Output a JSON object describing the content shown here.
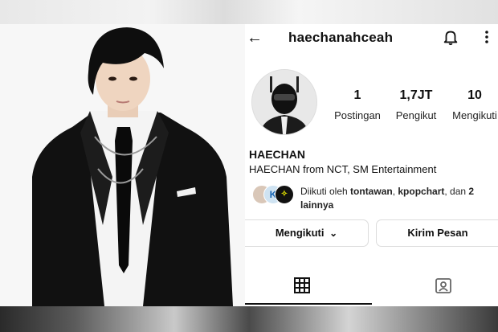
{
  "profile": {
    "username": "haechanahceah",
    "display_name": "HAECHAN",
    "bio": "HAECHAN from NCT, SM Entertainment",
    "stats": [
      {
        "value": "1",
        "label": "Postingan"
      },
      {
        "value": "1,7JT",
        "label": "Pengikut"
      },
      {
        "value": "10",
        "label": "Mengikuti"
      }
    ],
    "followed_by": {
      "prefix": "Diikuti oleh ",
      "accounts": [
        "tontawan",
        "kpopchart"
      ],
      "sep": ", ",
      "joiner": ", dan ",
      "others": "2 lainnya",
      "avatars": [
        {
          "name": "person-avatar",
          "badge": ""
        },
        {
          "name": "kpopchart-logo",
          "badge": "K"
        },
        {
          "name": "brand-logo",
          "badge": "✧"
        }
      ]
    }
  },
  "actions": {
    "follow_label": "Mengikuti",
    "follow_chevron": "⌄",
    "message_label": "Kirim Pesan"
  },
  "icons": {
    "back": "back-arrow-icon",
    "bell": "bell-icon",
    "more": "more-vertical-icon",
    "grid": "grid-icon",
    "tagged": "tagged-icon"
  },
  "colors": {
    "text": "#111111",
    "border": "#dcdcdc",
    "background": "#ffffff"
  }
}
